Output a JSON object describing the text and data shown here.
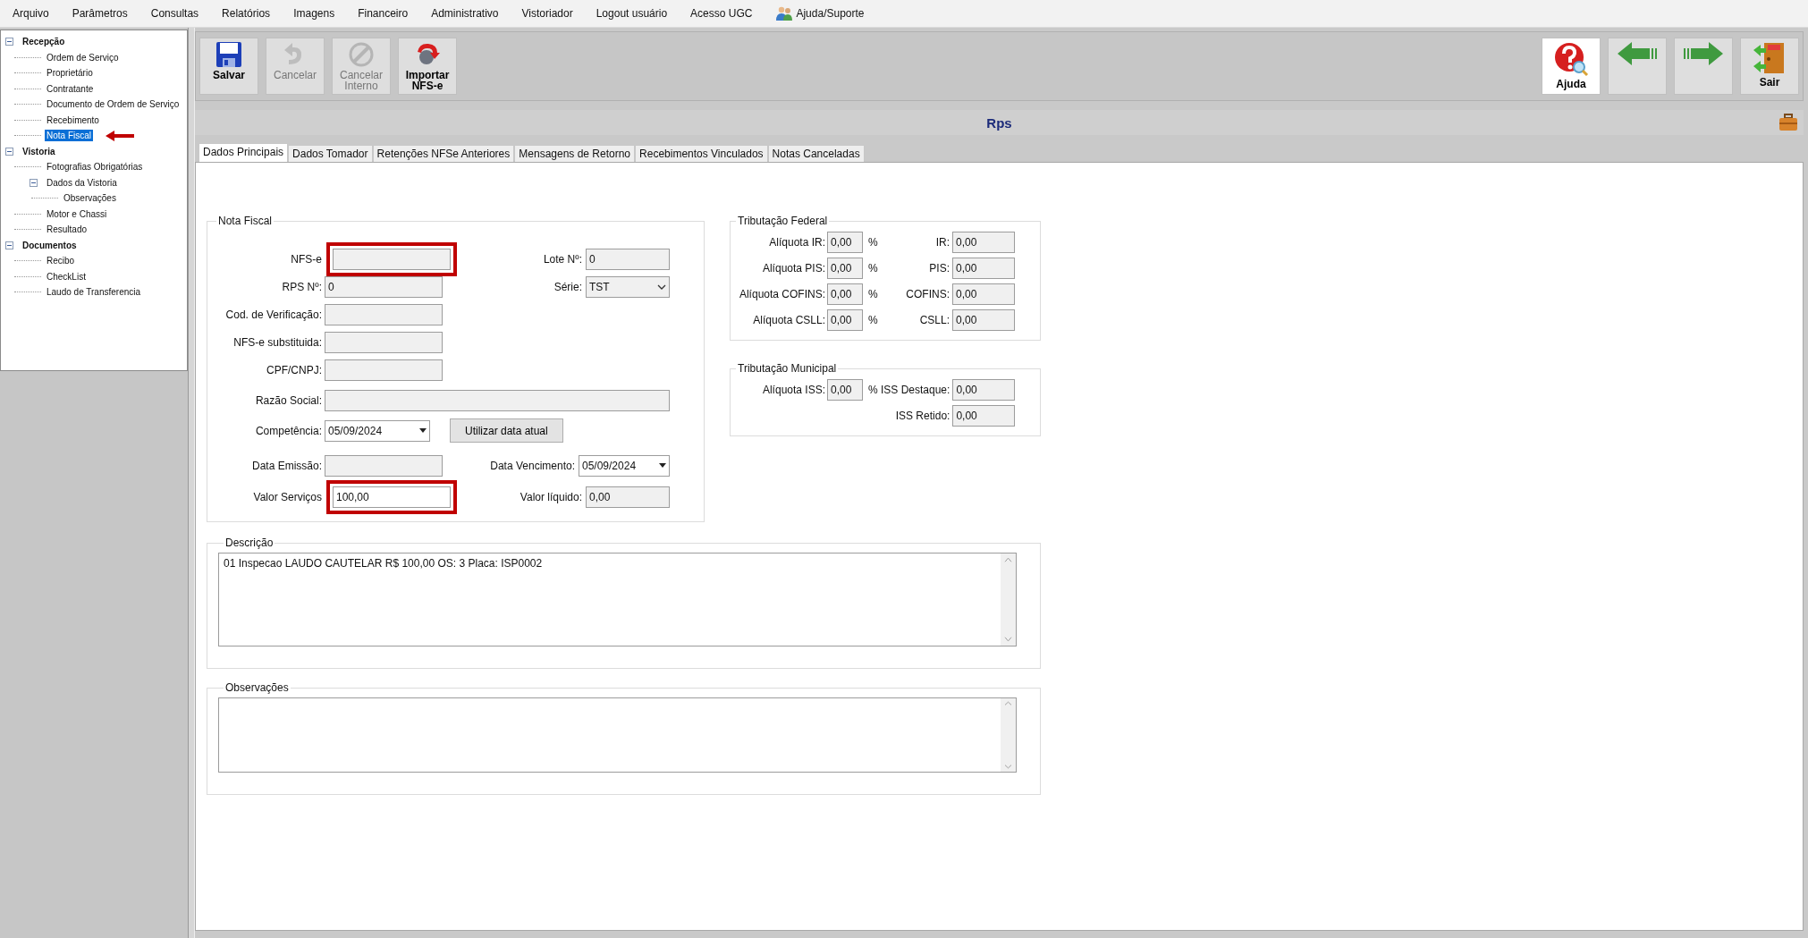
{
  "menu": [
    {
      "label": "Arquivo",
      "kind": "text"
    },
    {
      "label": "Parâmetros",
      "kind": "text"
    },
    {
      "label": "Consultas",
      "kind": "text"
    },
    {
      "label": "Relatórios",
      "kind": "text"
    },
    {
      "label": "Imagens",
      "kind": "text"
    },
    {
      "label": "Financeiro",
      "kind": "text"
    },
    {
      "label": "Administrativo",
      "kind": "text"
    },
    {
      "label": "Vistoriador",
      "kind": "text"
    },
    {
      "label": "Logout usuário",
      "kind": "text"
    },
    {
      "label": "Acesso UGC",
      "kind": "text"
    },
    {
      "label": "Ajuda/Suporte",
      "kind": "people"
    }
  ],
  "tree": [
    {
      "label": "Recepção",
      "expanded": true,
      "selected": false,
      "annotated": false,
      "children": [
        {
          "label": "Ordem de Serviço",
          "selected": false,
          "annotated": false
        },
        {
          "label": "Proprietário",
          "selected": false,
          "annotated": false
        },
        {
          "label": "Contratante",
          "selected": false,
          "annotated": false
        },
        {
          "label": "Documento de Ordem de Serviço",
          "selected": false,
          "annotated": false
        },
        {
          "label": "Recebimento",
          "selected": false,
          "annotated": false
        },
        {
          "label": "Nota Fiscal",
          "selected": true,
          "annotated": true
        }
      ]
    },
    {
      "label": "Vistoria",
      "expanded": true,
      "selected": false,
      "annotated": false,
      "children": [
        {
          "label": "Fotografias Obrigatórias",
          "selected": false,
          "annotated": false
        },
        {
          "label": "Dados da Vistoria",
          "expanded": true,
          "selected": false,
          "annotated": false,
          "children": [
            {
              "label": "Observações",
              "selected": false,
              "annotated": false
            }
          ]
        },
        {
          "label": "Motor e Chassi",
          "selected": false,
          "annotated": false
        },
        {
          "label": "Resultado",
          "selected": false,
          "annotated": false
        }
      ]
    },
    {
      "label": "Documentos",
      "expanded": true,
      "selected": false,
      "annotated": false,
      "children": [
        {
          "label": "Recibo",
          "selected": false,
          "annotated": false
        },
        {
          "label": "CheckList",
          "selected": false,
          "annotated": false
        },
        {
          "label": "Laudo de Transferencia",
          "selected": false,
          "annotated": false
        }
      ]
    }
  ],
  "toolbar": {
    "left": [
      {
        "kind": "save",
        "label": "Salvar",
        "enabled": true
      },
      {
        "kind": "undo",
        "label": "Cancelar",
        "enabled": false
      },
      {
        "kind": "prohibit",
        "label": "Cancelar Interno",
        "enabled": false
      },
      {
        "kind": "import",
        "label": "Importar NFS-e",
        "enabled": true
      }
    ],
    "right": [
      {
        "kind": "help",
        "label": "Ajuda",
        "enabled": true
      },
      {
        "kind": "back",
        "enabled": true
      },
      {
        "kind": "forward",
        "enabled": true
      },
      {
        "kind": "exit",
        "label": "Sair",
        "enabled": true
      }
    ]
  },
  "window": {
    "title": "Rps"
  },
  "tabs": [
    {
      "label": "Dados Principais",
      "selected": true
    },
    {
      "label": "Dados Tomador",
      "selected": false
    },
    {
      "label": "Retenções NFSe Anteriores",
      "selected": false
    },
    {
      "label": "Mensagens de Retorno",
      "selected": false
    },
    {
      "label": "Recebimentos Vinculados",
      "selected": false
    },
    {
      "label": "Notas Canceladas",
      "selected": false
    }
  ],
  "nota_fiscal": {
    "title": "Nota Fiscal",
    "rows": [
      {
        "left": {
          "kind": "field",
          "label": "NFS-e",
          "readonly": true,
          "highlighted": true
        },
        "right": {
          "kind": "field",
          "label": "Lote Nº:",
          "value": "0",
          "readonly": true,
          "highlighted": false
        }
      },
      {
        "left": {
          "kind": "field",
          "label": "RPS Nº:",
          "value": "0",
          "readonly": true,
          "highlighted": false
        },
        "right": {
          "kind": "select",
          "label": "Série:",
          "value": "TST",
          "readonly": true,
          "highlighted": false
        }
      },
      {
        "left": {
          "kind": "field",
          "label": "Cod. de Verificação:",
          "readonly": true,
          "highlighted": false
        }
      },
      {
        "left": {
          "kind": "field",
          "label": "NFS-e substituida:",
          "readonly": true,
          "highlighted": false
        }
      },
      {
        "left": {
          "kind": "field",
          "label": "CPF/CNPJ:",
          "readonly": true,
          "highlighted": false
        }
      },
      {
        "left": {
          "kind": "wide-field",
          "label": "Razão Social:",
          "readonly": true,
          "highlighted": false
        }
      },
      {
        "left": {
          "kind": "date",
          "label": "Competência:",
          "value": "05/09/2024",
          "readonly": false,
          "highlighted": false
        },
        "right": {
          "kind": "button",
          "value": "Utilizar data atual",
          "readonly": false,
          "highlighted": false
        }
      },
      {
        "left": {
          "kind": "field",
          "label": "Data Emissão:",
          "readonly": true,
          "highlighted": false
        },
        "right": {
          "kind": "date",
          "label": "Data Vencimento:",
          "value": "05/09/2024",
          "readonly": false,
          "highlighted": false
        }
      },
      {
        "left": {
          "kind": "field",
          "label": "Valor Serviços",
          "value": "100,00",
          "readonly": false,
          "highlighted": true
        },
        "right": {
          "kind": "field",
          "label": "Valor líquido:",
          "value": "0,00",
          "readonly": true,
          "highlighted": false
        }
      }
    ]
  },
  "tributacao_federal": {
    "title": "Tributação Federal",
    "rows": [
      {
        "rate_label": "Alíquota IR:",
        "rate": "0,00",
        "unit": "%",
        "amount_label": "IR:",
        "amount": "0,00"
      },
      {
        "rate_label": "Alíquota PIS:",
        "rate": "0,00",
        "unit": "%",
        "amount_label": "PIS:",
        "amount": "0,00"
      },
      {
        "rate_label": "Alíquota COFINS:",
        "rate": "0,00",
        "unit": "%",
        "amount_label": "COFINS:",
        "amount": "0,00"
      },
      {
        "rate_label": "Alíquota CSLL:",
        "rate": "0,00",
        "unit": "%",
        "amount_label": "CSLL:",
        "amount": "0,00"
      }
    ]
  },
  "tributacao_municipal": {
    "title": "Tributação Municipal",
    "rows": [
      {
        "rate_label": "Alíquota ISS:",
        "rate": "0,00",
        "unit": "%",
        "amount_label": "ISS Destaque:",
        "amount": "0,00"
      },
      {
        "amount_label": "ISS Retido:",
        "amount": "0,00"
      }
    ]
  },
  "descricao": {
    "title": "Descrição",
    "value": "01 Inspecao LAUDO CAUTELAR R$ 100,00 OS: 3 Placa: ISP0002"
  },
  "observacoes": {
    "title": "Observações"
  }
}
